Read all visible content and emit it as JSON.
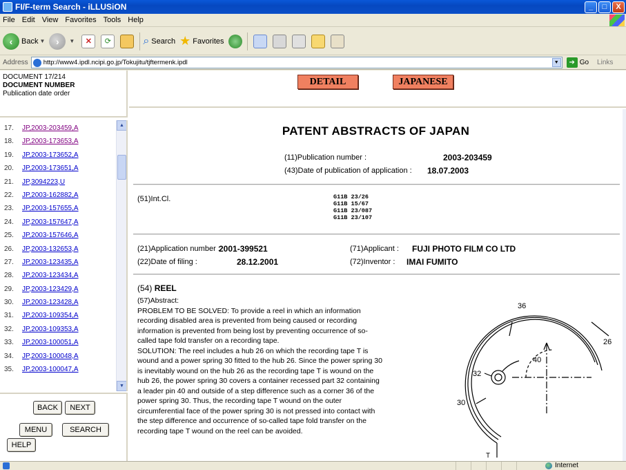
{
  "window": {
    "title": "FI/F-term Search - iLLUSiON",
    "buttons": [
      "_",
      "□",
      "X"
    ]
  },
  "menu": [
    "File",
    "Edit",
    "View",
    "Favorites",
    "Tools",
    "Help"
  ],
  "toolbar": {
    "back": "Back",
    "search": "Search",
    "favorites": "Favorites"
  },
  "address": {
    "label": "Address",
    "url": "http://www4.ipdl.ncipi.go.jp/Tokujitu/tjftermenk.ipdl",
    "go": "Go",
    "links": "Links"
  },
  "left_header": {
    "document": "DOCUMENT  17/214",
    "document_number": "DOCUMENT NUMBER",
    "order": "Publication date order"
  },
  "doc_list": [
    {
      "num": "17.",
      "id": "JP,2003-203459,A",
      "visited": true
    },
    {
      "num": "18.",
      "id": "JP,2003-173653,A",
      "visited": true
    },
    {
      "num": "19.",
      "id": "JP,2003-173652,A",
      "visited": false
    },
    {
      "num": "20.",
      "id": "JP,2003-173651,A",
      "visited": false
    },
    {
      "num": "21.",
      "id": "JP,3094223,U",
      "visited": false
    },
    {
      "num": "22.",
      "id": "JP,2003-162882,A",
      "visited": false
    },
    {
      "num": "23.",
      "id": "JP,2003-157655,A",
      "visited": false
    },
    {
      "num": "24.",
      "id": "JP,2003-157647,A",
      "visited": false
    },
    {
      "num": "25.",
      "id": "JP,2003-157646,A",
      "visited": false
    },
    {
      "num": "26.",
      "id": "JP,2003-132653,A",
      "visited": false
    },
    {
      "num": "27.",
      "id": "JP,2003-123435,A",
      "visited": false
    },
    {
      "num": "28.",
      "id": "JP,2003-123434,A",
      "visited": false
    },
    {
      "num": "29.",
      "id": "JP,2003-123429,A",
      "visited": false
    },
    {
      "num": "30.",
      "id": "JP,2003-123428,A",
      "visited": false
    },
    {
      "num": "31.",
      "id": "JP,2003-109354,A",
      "visited": false
    },
    {
      "num": "32.",
      "id": "JP,2003-109353,A",
      "visited": false
    },
    {
      "num": "33.",
      "id": "JP,2003-100051,A",
      "visited": false
    },
    {
      "num": "34.",
      "id": "JP,2003-100048,A",
      "visited": false
    },
    {
      "num": "35.",
      "id": "JP,2003-100047,A",
      "visited": false
    }
  ],
  "nav_buttons": {
    "back": "BACK",
    "next": "NEXT",
    "menu": "MENU",
    "search": "SEARCH",
    "help": "HELP"
  },
  "top_buttons": {
    "detail": "DETAIL",
    "japanese": "JAPANESE"
  },
  "patent": {
    "heading": "PATENT ABSTRACTS OF JAPAN",
    "pub_number_label": "(11)Publication number :",
    "pub_number": "2003-203459",
    "pub_date_label": "(43)Date of publication of application :",
    "pub_date": "18.07.2003",
    "intcl_label": "(51)Int.Cl.",
    "intcl": [
      "G11B 23/26",
      "G11B 15/67",
      "G11B 23/087",
      "G11B 23/107"
    ],
    "app_number_label": "(21)Application number :",
    "app_number": "2001-399521",
    "applicant_label": "(71)Applicant :",
    "applicant": "FUJI PHOTO FILM CO LTD",
    "filing_label": "(22)Date of filing :",
    "filing_date": "28.12.2001",
    "inventor_label": "(72)Inventor :",
    "inventor": "IMAI FUMITO",
    "title_label": "(54)",
    "title": "REEL",
    "abstract_label": "(57)Abstract:",
    "abstract_lines": [
      "PROBLEM TO BE SOLVED: To provide a reel in which an information",
      "recording disabled area is prevented from being caused or recording",
      "information is prevented from being lost by preventing occurrence of so-",
      "called tape fold transfer on a recording tape.",
      "SOLUTION: The reel includes a hub 26 on which the recording tape T is",
      "wound and a power spring 30 fitted to the hub 26. Since the power spring 30",
      "is inevitably wound on the hub 26 as the recording tape T is wound on the",
      "hub 26, the power spring 30 covers a container recessed part 32 containing",
      "a leader pin 40 and outside of a step difference such as a corner 36 of the",
      "power spring 30. Thus, the recording tape T wound on the outer",
      "circumferential face of the power spring 30 is not pressed into contact with",
      "the step difference and occurrence of so-called tape fold transfer on the",
      "recording tape T wound on the reel can be avoided."
    ],
    "drawing_labels": {
      "l36": "36",
      "l26": "26",
      "l32": "32",
      "l40": "40",
      "l30": "30",
      "lT": "T"
    }
  },
  "status": {
    "zone": "Internet"
  }
}
